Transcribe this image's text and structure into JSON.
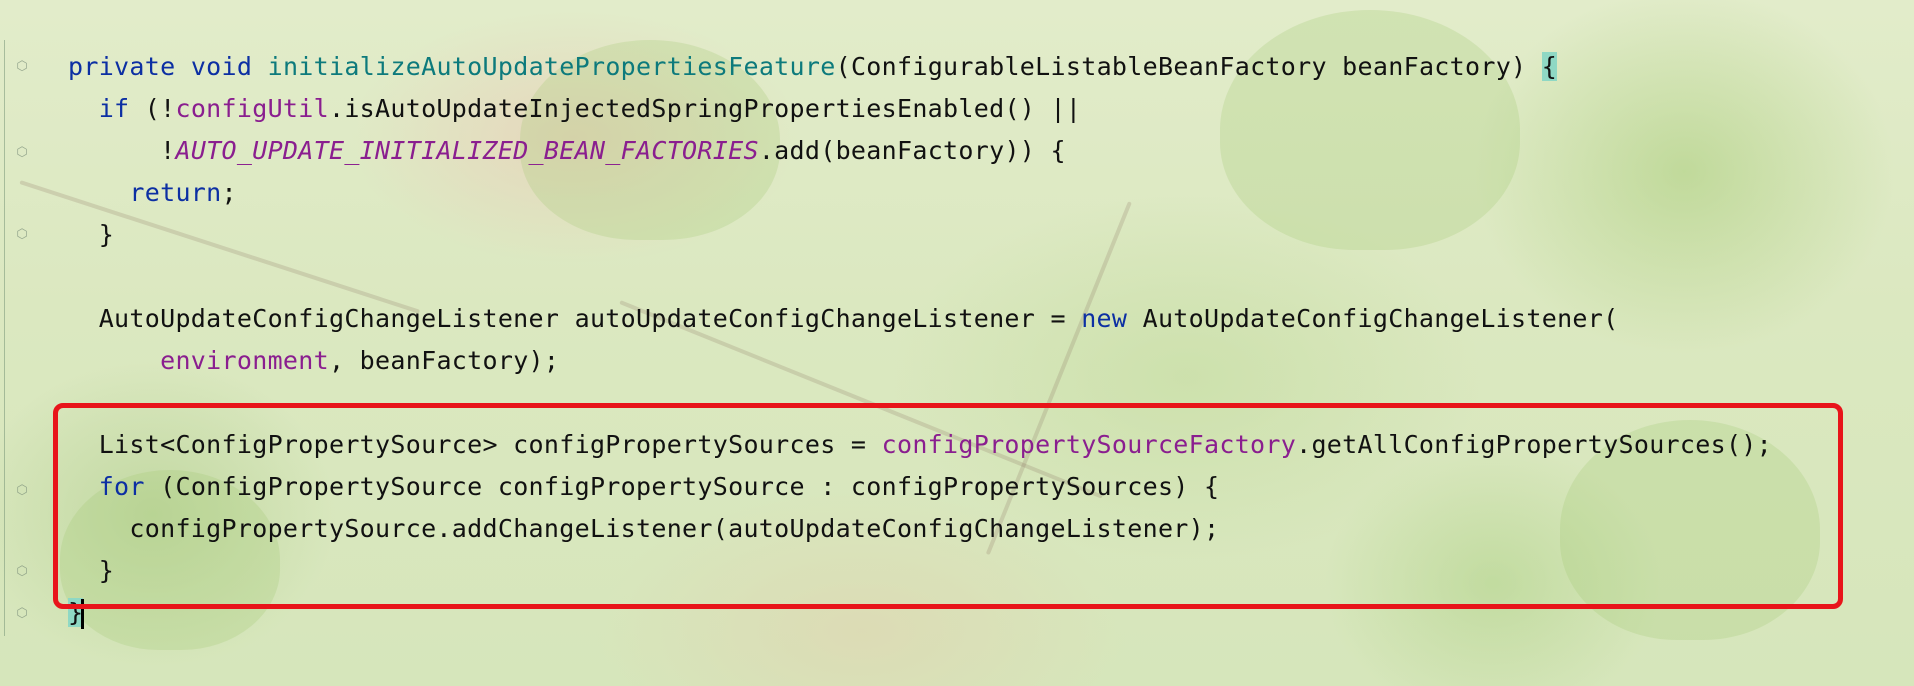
{
  "editor": {
    "lines": [
      {
        "indent": "",
        "tokens": [
          {
            "t": "private",
            "c": "kw"
          },
          {
            "t": " ",
            "c": ""
          },
          {
            "t": "void",
            "c": "kw"
          },
          {
            "t": " ",
            "c": ""
          },
          {
            "t": "initializeAutoUpdatePropertiesFeature",
            "c": "fn"
          },
          {
            "t": "(ConfigurableListableBeanFactory beanFactory) ",
            "c": ""
          },
          {
            "t": "{",
            "c": "brace-hl"
          }
        ]
      },
      {
        "indent": "  ",
        "tokens": [
          {
            "t": "if",
            "c": "kw"
          },
          {
            "t": " (!",
            "c": ""
          },
          {
            "t": "configUtil",
            "c": "fld"
          },
          {
            "t": ".isAutoUpdateInjectedSpringPropertiesEnabled() ||",
            "c": ""
          }
        ]
      },
      {
        "indent": "      ",
        "tokens": [
          {
            "t": "!",
            "c": ""
          },
          {
            "t": "AUTO_UPDATE_INITIALIZED_BEAN_FACTORIES",
            "c": "const"
          },
          {
            "t": ".add(beanFactory)) {",
            "c": ""
          }
        ]
      },
      {
        "indent": "    ",
        "tokens": [
          {
            "t": "return",
            "c": "kw"
          },
          {
            "t": ";",
            "c": ""
          }
        ]
      },
      {
        "indent": "  ",
        "tokens": [
          {
            "t": "}",
            "c": ""
          }
        ]
      },
      {
        "indent": "",
        "tokens": []
      },
      {
        "indent": "  ",
        "tokens": [
          {
            "t": "AutoUpdateConfigChangeListener autoUpdateConfigChangeListener = ",
            "c": ""
          },
          {
            "t": "new",
            "c": "kw"
          },
          {
            "t": " AutoUpdateConfigChangeListener(",
            "c": ""
          }
        ]
      },
      {
        "indent": "      ",
        "tokens": [
          {
            "t": "environment",
            "c": "fld"
          },
          {
            "t": ", beanFactory);",
            "c": ""
          }
        ]
      },
      {
        "indent": "",
        "tokens": []
      },
      {
        "indent": "  ",
        "tokens": [
          {
            "t": "List<ConfigPropertySource> configPropertySources = ",
            "c": ""
          },
          {
            "t": "configPropertySourceFactory",
            "c": "fld"
          },
          {
            "t": ".getAllConfigPropertySources();",
            "c": ""
          }
        ]
      },
      {
        "indent": "  ",
        "tokens": [
          {
            "t": "for",
            "c": "kw"
          },
          {
            "t": " (ConfigPropertySource configPropertySource : configPropertySources) {",
            "c": ""
          }
        ]
      },
      {
        "indent": "    ",
        "tokens": [
          {
            "t": "configPropertySource.addChangeListener(autoUpdateConfigChangeListener);",
            "c": ""
          }
        ]
      },
      {
        "indent": "  ",
        "tokens": [
          {
            "t": "}",
            "c": ""
          }
        ]
      },
      {
        "indent": "",
        "tokens": [
          {
            "t": "}",
            "c": "brace-hl"
          }
        ],
        "caret": true
      }
    ]
  },
  "colors": {
    "keyword": "#0c2fa3",
    "method_declaration": "#0d7a7c",
    "field": "#8a1e8f",
    "highlight_box": "#e8141a",
    "brace_match": "#8fd8c4"
  }
}
